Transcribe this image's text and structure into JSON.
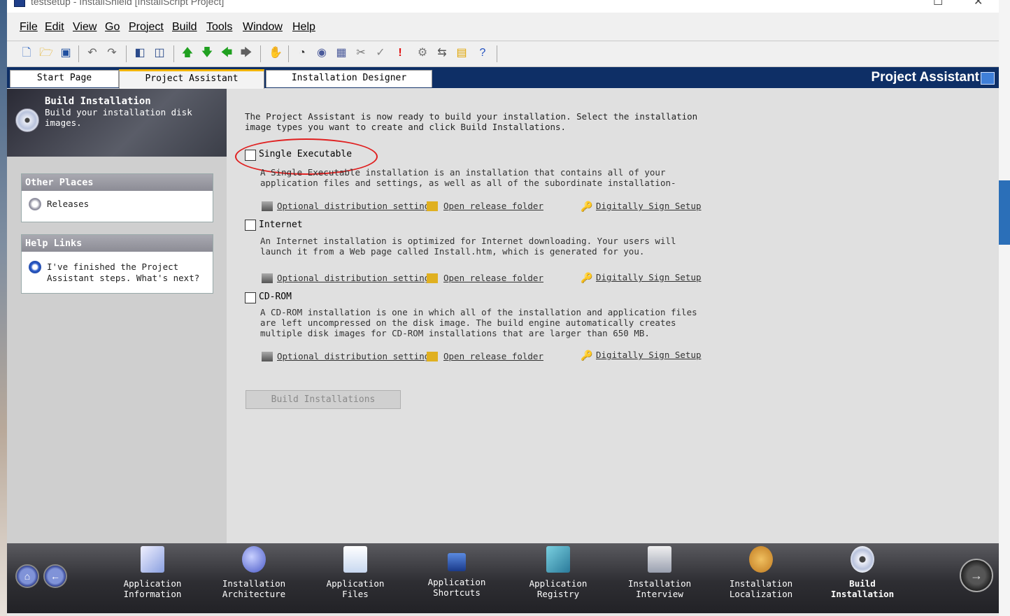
{
  "window": {
    "title": "testsetup - InstallShield [InstallScript Project]"
  },
  "menu": [
    "File",
    "Edit",
    "View",
    "Go",
    "Project",
    "Build",
    "Tools",
    "Window",
    "Help"
  ],
  "toolbar_icons": [
    "new-file-icon",
    "open-folder-icon",
    "save-icon",
    "undo-icon",
    "redo-icon",
    "panel-left-icon",
    "panel-split-icon",
    "arrow-up-icon",
    "arrow-down-icon",
    "arrow-left-icon",
    "arrow-right-icon",
    "hand-icon",
    "compile-icon",
    "build-icon",
    "media-icon",
    "tools-icon",
    "check-icon",
    "error-icon",
    "settings-icon",
    "release-icon",
    "package-icon",
    "help-icon"
  ],
  "tabs": [
    "Start Page",
    "Project Assistant",
    "Installation Designer"
  ],
  "header": {
    "title": "Project Assistant"
  },
  "left": {
    "build_title": "Build Installation",
    "build_sub": "Build your installation disk images.",
    "other_places_title": "Other Places",
    "releases": "Releases",
    "help_links_title": "Help Links",
    "help_item": "I've finished the Project Assistant steps. What's next?"
  },
  "main": {
    "intro": "The Project Assistant is now ready to build your installation. Select the installation image types you want to create and click Build Installations.",
    "options": [
      {
        "label": "Single Executable",
        "checked": false,
        "desc": "A Single Executable installation is an installation that contains all of your application files and settings, as well as all of the subordinate installation-related files required."
      },
      {
        "label": "Internet",
        "checked": false,
        "desc": "An Internet installation is optimized for Internet downloading. Your users will launch it from a Web page called Install.htm, which is generated for you."
      },
      {
        "label": "CD-ROM",
        "checked": false,
        "desc": "A CD-ROM installation is one in which all of the installation and application files are left uncompressed on the disk image. The build engine automatically creates multiple disk images for CD-ROM installations that are larger than 650 MB."
      }
    ],
    "links": {
      "optional": "Optional distribution settings",
      "open_release": "Open release folder",
      "sign": "Digitally Sign Setup"
    },
    "build_button": "Build Installations"
  },
  "steps": [
    {
      "l1": "Application",
      "l2": "Information",
      "icon": "application-information-icon"
    },
    {
      "l1": "Installation",
      "l2": "Architecture",
      "icon": "installation-architecture-icon"
    },
    {
      "l1": "Application",
      "l2": "Files",
      "icon": "application-files-icon"
    },
    {
      "l1": "Application",
      "l2": "Shortcuts",
      "icon": "application-shortcuts-icon"
    },
    {
      "l1": "Application",
      "l2": "Registry",
      "icon": "application-registry-icon"
    },
    {
      "l1": "Installation",
      "l2": "Interview",
      "icon": "installation-interview-icon"
    },
    {
      "l1": "Installation",
      "l2": "Localization",
      "icon": "installation-localization-icon"
    },
    {
      "l1": "Build",
      "l2": "Installation",
      "icon": "build-installation-icon"
    }
  ],
  "colors": {
    "nav_dark": "#0e2f66",
    "accent_tab": "#f0b400",
    "annotation": "#e02020"
  }
}
